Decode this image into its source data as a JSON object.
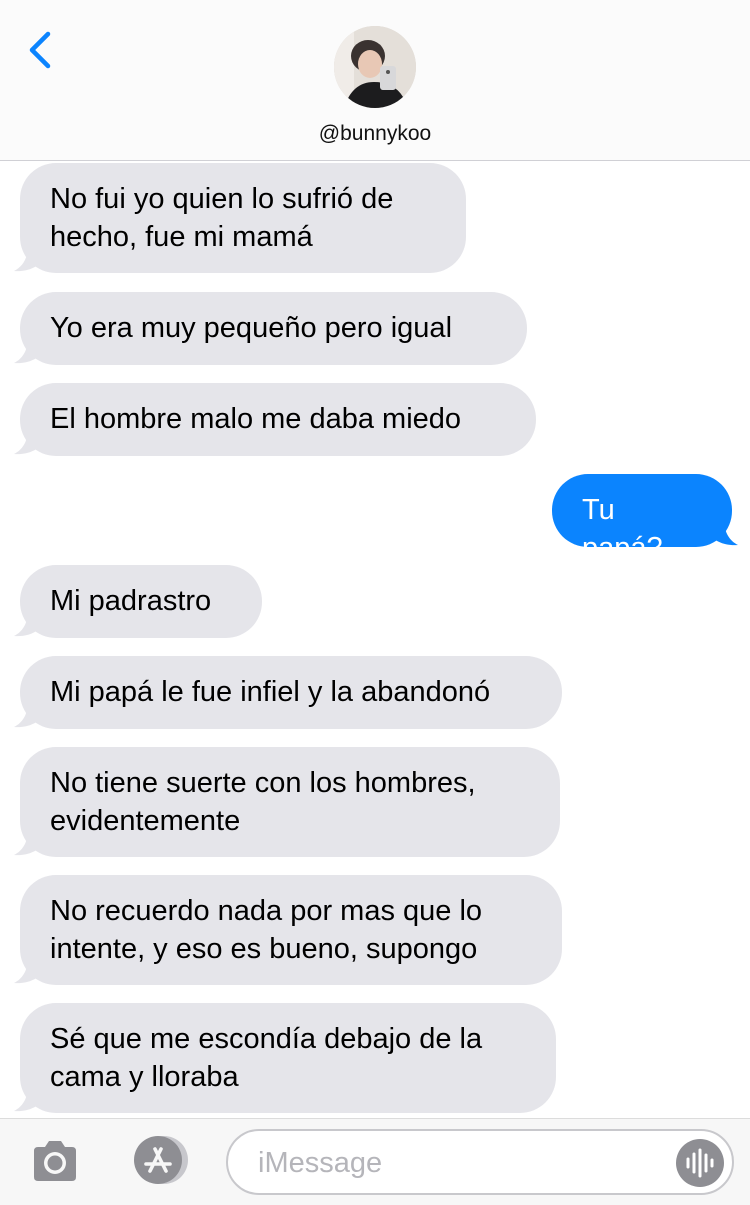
{
  "header": {
    "handle": "@bunnykoo"
  },
  "messages": [
    {
      "side": "in",
      "text": "No fui yo quien lo sufrió de\nhecho, fue mi mamá"
    },
    {
      "side": "in",
      "text": "Yo era muy pequeño pero igual"
    },
    {
      "side": "in",
      "text": "El hombre malo me daba miedo"
    },
    {
      "side": "out",
      "text": "Tu papá?"
    },
    {
      "side": "in",
      "text": "Mi padrastro"
    },
    {
      "side": "in",
      "text": "Mi papá le fue infiel y la abandonó"
    },
    {
      "side": "in",
      "text": "No tiene suerte con los hombres,\nevidentemente"
    },
    {
      "side": "in",
      "text": "No recuerdo nada por mas que lo\nintente, y eso es bueno, supongo"
    },
    {
      "side": "in",
      "text": "Sé que me escondía debajo de la\ncama y lloraba"
    }
  ],
  "composer": {
    "placeholder": "iMessage"
  },
  "colors": {
    "accent": "#0b84fe",
    "incoming_bubble": "#e5e5ea",
    "icon_gray": "#8e8e93"
  }
}
